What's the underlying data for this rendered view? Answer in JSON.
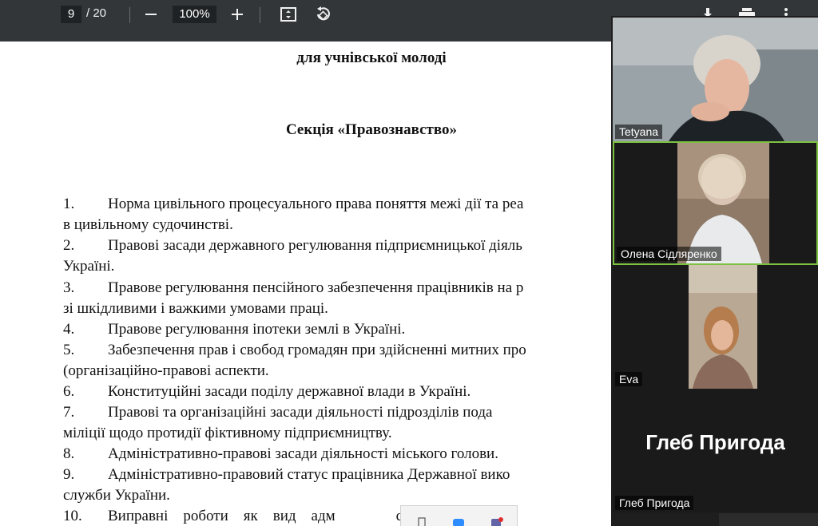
{
  "pdf_toolbar": {
    "current_page": "9",
    "total_pages": "/ 20",
    "zoom_level": "100%"
  },
  "document": {
    "heading_top": "для учнівської молоді",
    "section_title": "Секція «Правознавство»",
    "items": [
      {
        "num": "1.",
        "line1": "Норма цивільного процесуального права поняття межі дії та реа",
        "line2": "в цивільному судочинстві."
      },
      {
        "num": "2.",
        "line1": "Правові засади державного регулювання підприємницької діяль",
        "line2": "Україні."
      },
      {
        "num": "3.",
        "line1": "Правове регулювання пенсійного забезпечення працівників на р",
        "line2": "зі шкідливими і важкими умовами праці."
      },
      {
        "num": "4.",
        "line1": "Правове регулювання іпотеки землі в Україні.",
        "line2": ""
      },
      {
        "num": "5.",
        "line1": "Забезпечення прав і свобод громадян при здійсненні митних про",
        "line2": "(організаційно-правові аспекти."
      },
      {
        "num": "6.",
        "line1": "Конституційні засади поділу державної влади в Україні.",
        "line2": ""
      },
      {
        "num": "7.",
        "line1": "Правові та організаційні засади діяльності підрозділів пода",
        "line2": "міліції щодо протидії фіктивному підприємництву."
      },
      {
        "num": "8.",
        "line1": "Адміністративно-правові засади діяльності міського голови.",
        "line2": ""
      },
      {
        "num": "9.",
        "line1": "Адміністративно-правовий статус працівника Державної вико",
        "line2": "служби України."
      },
      {
        "num": "10.",
        "line1": "Виправні    роботи    як    вид    адм                стягнення    за",
        "line2": ""
      }
    ]
  },
  "video_tiles": [
    {
      "name": "Tetyana"
    },
    {
      "name": "Олена Сідляренко"
    },
    {
      "name": "Eva"
    },
    {
      "name": "Глеб Пригода",
      "display_name": "Глеб Пригода"
    }
  ],
  "colors": {
    "toolbar_bg": "#323639",
    "active_speaker_border": "#7cc242",
    "tile_bg": "#1a1a1a"
  }
}
